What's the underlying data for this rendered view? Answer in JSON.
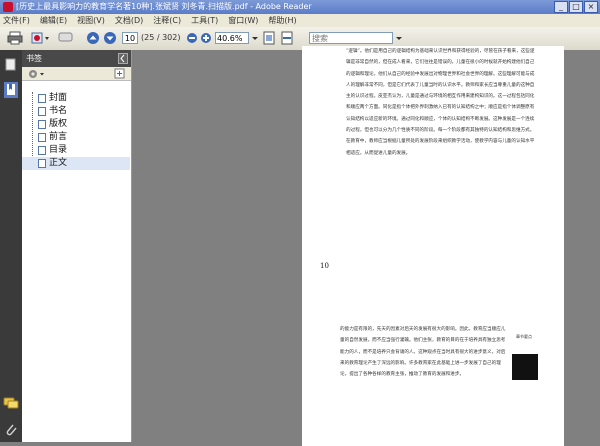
{
  "window": {
    "title": "[历史上最具影响力的教育学名著10种].张斌贤 刘冬青.扫描版.pdf - Adobe Reader"
  },
  "menu": [
    "文件(F)",
    "编辑(E)",
    "视图(V)",
    "文档(D)",
    "注释(C)",
    "工具(T)",
    "窗口(W)",
    "帮助(H)"
  ],
  "toolbar": {
    "page_value": "10",
    "page_count": "(25 / 302)",
    "zoom_value": "40.6%",
    "search_placeholder": "搜索"
  },
  "bookmarks": {
    "header": "书签",
    "items": [
      "封面",
      "书名",
      "版权",
      "前言",
      "目录",
      "正文"
    ],
    "selected_index": 5
  },
  "document": {
    "page_number": "10",
    "page1_text": "“逻辑”。他们是用自己的逻辑结构为基础来认识世界和获得经验的，尽管在孩子看来，这些逻辑是非常自然的，但在成人看来，它们往往是错误的。儿童在很小的时候就开始构建他们自己的逻辑和理论。他们从自己的经验中发展出对物理世界和社会世界的理解。这些理解可能与成人的理解非常不同，但是它们代表了儿童当时的认识水平。教师和家长应当尊重儿童的这种自主的认识过程。皮亚杰认为，儿童是通过与环境的相互作用来建构知识的。这一过程包括同化和顺应两个方面。同化是指个体把外界刺激纳入已有的认知结构之中；顺应是指个体调整原有认知结构以适应新的环境。通过同化和顺应，个体的认知结构不断发展。这种发展是一个连续的过程，但也可以分为几个性质不同的阶段。每一个阶段都有其独特的认知结构和思维方式。在教育中，教师应当根据儿童所处的发展阶段来组织教学活动，使教学内容与儿童的认知水平相适应，从而促进儿童的发展。",
    "page2_text": "的能力是有限的，先天的因素对后天的发展有很大的影响。因此，教育应当顺应儿童的自然发展，而不应当强行灌输。他们主张，教育的目的在于培养具有独立思考能力的人，而不是培养只会背诵的人。这种观点在当时具有很大的进步意义，对后来的教育理论产生了深远的影响。许多教育家在此基础上进一步发展了自己的理论，提出了各种各样的教育主张，推动了教育的发展和进步。",
    "side_note": "章节要点"
  }
}
